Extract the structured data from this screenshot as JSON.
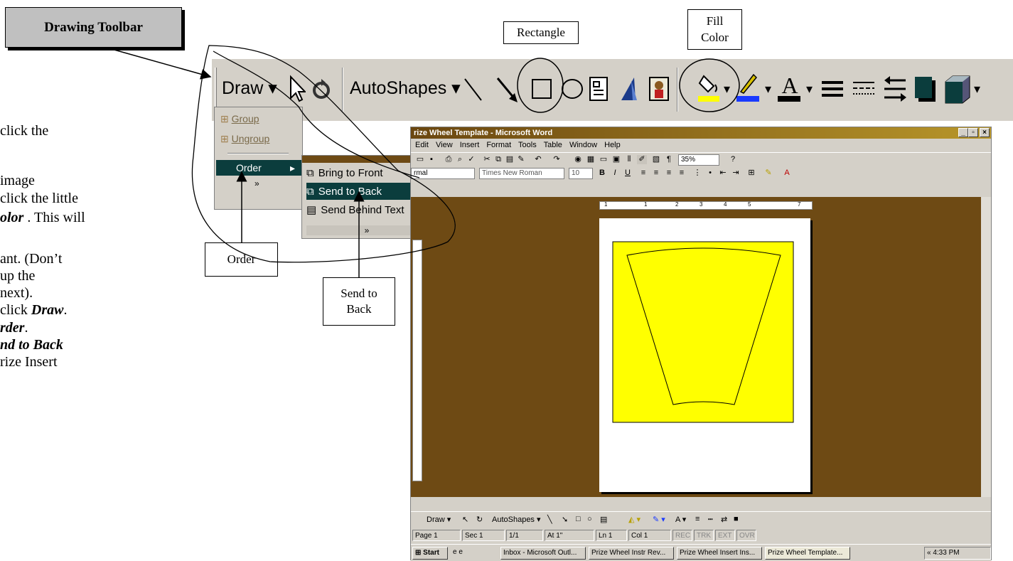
{
  "callouts": {
    "drawing_toolbar": "Drawing Toolbar",
    "rectangle": "Rectangle",
    "fill_color": [
      "Fill",
      "Color"
    ],
    "order": "Order",
    "send_to_back": [
      "Send to",
      "Back"
    ]
  },
  "instructions": [
    {
      "plain": "click the",
      "bold": ""
    },
    {
      "plain": " image",
      "bold": ""
    },
    {
      "plain": "click the little",
      "bold": ""
    },
    {
      "plain": "",
      "bold": "olor",
      "after": " . This will"
    },
    {
      "plain": "ant.  (Don’t",
      "bold": ""
    },
    {
      "plain": "up the",
      "bold": ""
    },
    {
      "plain": "next).",
      "bold": ""
    },
    {
      "plain": "click ",
      "bold": "Draw",
      "after": "."
    },
    {
      "plain": "",
      "bold": "rder",
      "after": "."
    },
    {
      "plain": "",
      "bold": "nd to Back",
      "after": ""
    },
    {
      "plain": "rize Insert",
      "bold": ""
    }
  ],
  "drawing_toolbar": {
    "draw_label": "Draw",
    "autoshapes_label": "AutoShapes"
  },
  "draw_menu": {
    "items": [
      "Group",
      "Ungroup",
      "Order"
    ]
  },
  "order_menu": {
    "items": [
      "Bring to Front",
      "Send to Back",
      "Send Behind Text"
    ]
  },
  "word": {
    "title": "rize Wheel Template - Microsoft Word",
    "menu": [
      "Edit",
      "View",
      "Insert",
      "Format",
      "Tools",
      "Table",
      "Window",
      "Help"
    ],
    "style_value": "rmal",
    "font_value": "Times New Roman",
    "size_value": "10",
    "zoom_value": "35%",
    "ruler_numbers": [
      "1",
      "1",
      "2",
      "3",
      "4",
      "5",
      "7"
    ],
    "drawbar_draw": "Draw",
    "drawbar_autoshapes": "AutoShapes",
    "status": {
      "page": "Page 1",
      "sec": "Sec 1",
      "pages": "1/1",
      "at": "At 1\"",
      "ln": "Ln 1",
      "col": "Col 1",
      "rec": "REC",
      "trk": "TRK",
      "ext": "EXT",
      "ovr": "OVR"
    },
    "taskbar": {
      "start": "Start",
      "tasks": [
        "Inbox - Microsoft Outl...",
        "Prize Wheel Instr Rev...",
        "Prize Wheel Insert Ins...",
        "Prize Wheel Template..."
      ],
      "clock": "4:33 PM"
    }
  },
  "colors": {
    "doc_bg": "#6e4a14",
    "page_fill": "#ffff00",
    "highlight": "#0b3d3d",
    "toolbar": "#d4d0c8"
  }
}
